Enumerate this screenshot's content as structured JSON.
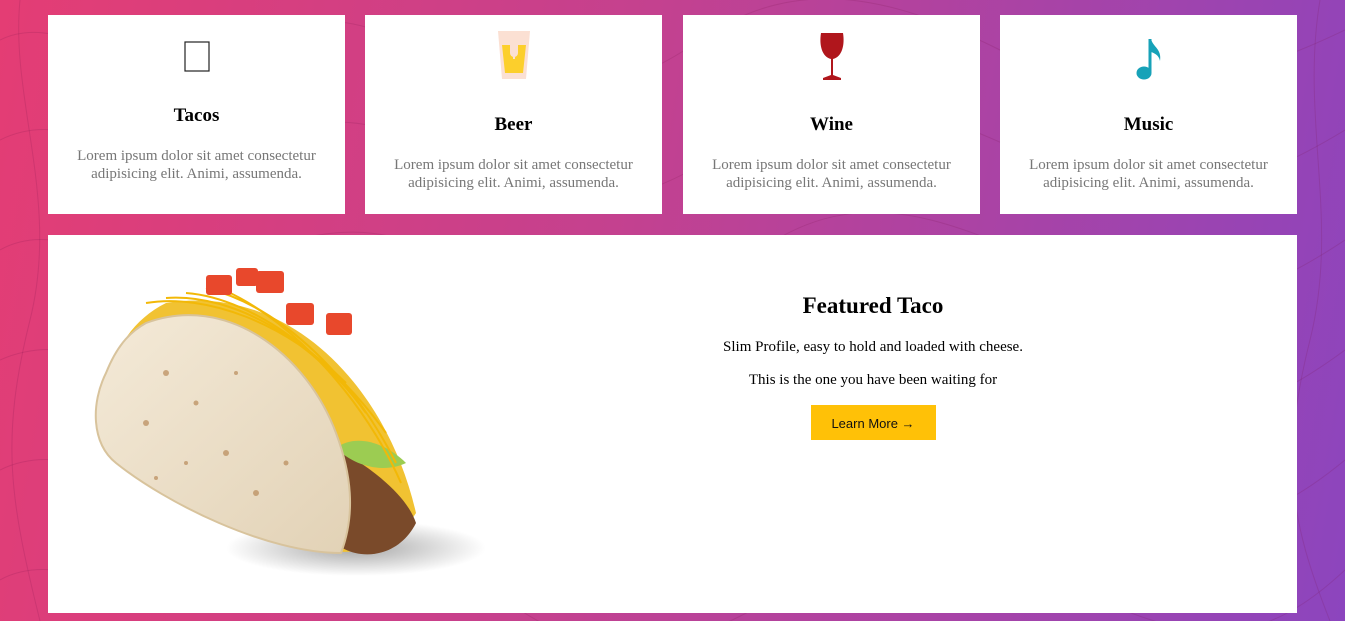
{
  "features": [
    {
      "icon": "taco-icon",
      "title": "Tacos",
      "text": "Lorem ipsum dolor sit amet consectetur adipisicing elit. Animi, assumenda."
    },
    {
      "icon": "beer-icon",
      "title": "Beer",
      "text": "Lorem ipsum dolor sit amet consectetur adipisicing elit. Animi, assumenda."
    },
    {
      "icon": "wine-glass-icon",
      "title": "Wine",
      "text": "Lorem ipsum dolor sit amet consectetur adipisicing elit. Animi, assumenda."
    },
    {
      "icon": "music-note-icon",
      "title": "Music",
      "text": "Lorem ipsum dolor sit amet consectetur adipisicing elit. Animi, assumenda."
    }
  ],
  "featured": {
    "title": "Featured Taco",
    "line1": "Slim Profile, easy to hold and loaded with cheese.",
    "line2": "This is the one you have been waiting for",
    "button_label": "Learn More →",
    "image": "taco-image"
  },
  "colors": {
    "gradient_start": "#e43d74",
    "gradient_end": "#8c45be",
    "button": "#ffc107",
    "wine": "#b0161c",
    "music": "#17a2b8"
  }
}
